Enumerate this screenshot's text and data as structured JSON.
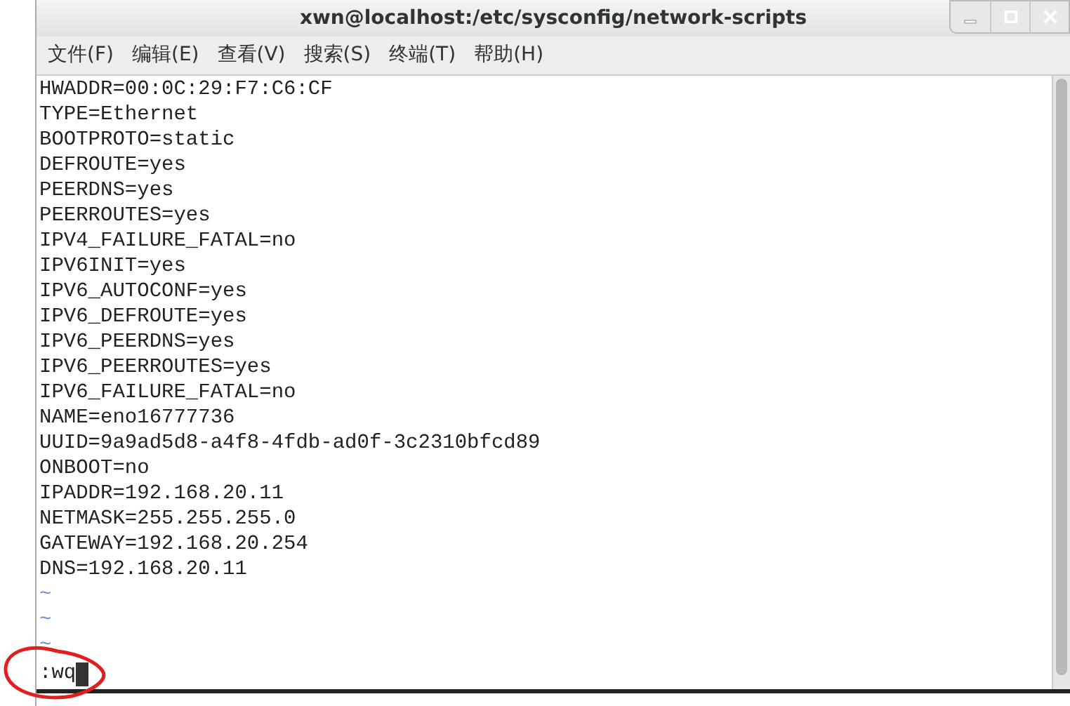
{
  "window": {
    "title": "xwn@localhost:/etc/sysconfig/network-scripts"
  },
  "menu": [
    "文件(F)",
    "编辑(E)",
    "查看(V)",
    "搜索(S)",
    "终端(T)",
    "帮助(H)"
  ],
  "lines": [
    {
      "kind": "text",
      "text": "HWADDR=00:0C:29:F7:C6:CF"
    },
    {
      "kind": "text",
      "text": "TYPE=Ethernet"
    },
    {
      "kind": "text",
      "text": "BOOTPROTO=static"
    },
    {
      "kind": "text",
      "text": "DEFROUTE=yes"
    },
    {
      "kind": "text",
      "text": "PEERDNS=yes"
    },
    {
      "kind": "text",
      "text": "PEERROUTES=yes"
    },
    {
      "kind": "text",
      "text": "IPV4_FAILURE_FATAL=no"
    },
    {
      "kind": "text",
      "text": "IPV6INIT=yes"
    },
    {
      "kind": "text",
      "text": "IPV6_AUTOCONF=yes"
    },
    {
      "kind": "text",
      "text": "IPV6_DEFROUTE=yes"
    },
    {
      "kind": "text",
      "text": "IPV6_PEERDNS=yes"
    },
    {
      "kind": "text",
      "text": "IPV6_PEERROUTES=yes"
    },
    {
      "kind": "text",
      "text": "IPV6_FAILURE_FATAL=no"
    },
    {
      "kind": "text",
      "text": "NAME=eno16777736"
    },
    {
      "kind": "text",
      "text": "UUID=9a9ad5d8-a4f8-4fdb-ad0f-3c2310bfcd89"
    },
    {
      "kind": "text",
      "text": "ONBOOT=no"
    },
    {
      "kind": "text",
      "text": "IPADDR=192.168.20.11"
    },
    {
      "kind": "text",
      "text": "NETMASK=255.255.255.0"
    },
    {
      "kind": "text",
      "text": "GATEWAY=192.168.20.254"
    },
    {
      "kind": "text",
      "text": "DNS=192.168.20.11"
    },
    {
      "kind": "tilde",
      "text": "~"
    },
    {
      "kind": "tilde",
      "text": "~"
    },
    {
      "kind": "tilde",
      "text": "~"
    }
  ],
  "command_line": {
    "value": ":wq"
  }
}
